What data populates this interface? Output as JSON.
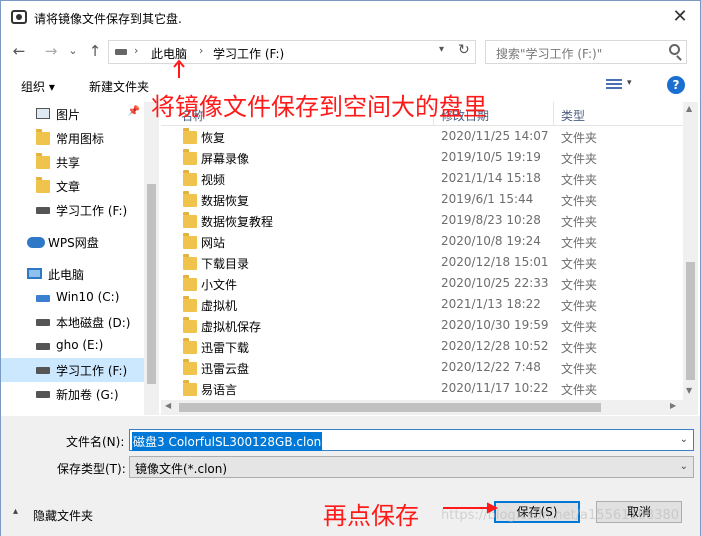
{
  "window": {
    "title": "请将镜像文件保存到其它盘.",
    "close": "✕"
  },
  "nav": {
    "back": "←",
    "forward": "→",
    "recent": "⌄",
    "up": "↑",
    "breadcrumb": [
      "此电脑",
      "学习工作 (F:)"
    ],
    "refresh": "↻",
    "search_placeholder": "搜索\"学习工作 (F:)\""
  },
  "toolbar": {
    "organize": "组织 ▾",
    "new_folder": "新建文件夹",
    "help": "?"
  },
  "sidebar": {
    "items": [
      {
        "label": "图片",
        "icon": "picture-icon"
      },
      {
        "label": "常用图标",
        "icon": "folder-icon"
      },
      {
        "label": "共享",
        "icon": "folder-icon"
      },
      {
        "label": "文章",
        "icon": "folder-icon"
      },
      {
        "label": "学习工作 (F:)",
        "icon": "drive-icon"
      },
      {
        "label": "WPS网盘",
        "icon": "cloud-icon"
      },
      {
        "label": "此电脑",
        "icon": "computer-icon"
      },
      {
        "label": "Win10 (C:)",
        "icon": "windows-drive-icon"
      },
      {
        "label": "本地磁盘 (D:)",
        "icon": "drive-icon"
      },
      {
        "label": "gho (E:)",
        "icon": "drive-icon"
      },
      {
        "label": "学习工作 (F:)",
        "icon": "drive-icon",
        "selected": true
      },
      {
        "label": "新加卷 (G:)",
        "icon": "drive-icon"
      }
    ]
  },
  "list": {
    "columns": [
      "名称",
      "修改日期",
      "类型"
    ],
    "rows": [
      {
        "name": "恢复",
        "date": "2020/11/25 14:07",
        "type": "文件夹"
      },
      {
        "name": "屏幕录像",
        "date": "2019/10/5 19:19",
        "type": "文件夹"
      },
      {
        "name": "视频",
        "date": "2021/1/14 15:18",
        "type": "文件夹"
      },
      {
        "name": "数据恢复",
        "date": "2019/6/1 15:44",
        "type": "文件夹"
      },
      {
        "name": "数据恢复教程",
        "date": "2019/8/23 10:28",
        "type": "文件夹"
      },
      {
        "name": "网站",
        "date": "2020/10/8 19:24",
        "type": "文件夹"
      },
      {
        "name": "下载目录",
        "date": "2020/12/18 15:01",
        "type": "文件夹"
      },
      {
        "name": "小文件",
        "date": "2020/10/25 22:33",
        "type": "文件夹"
      },
      {
        "name": "虚拟机",
        "date": "2021/1/13 18:22",
        "type": "文件夹"
      },
      {
        "name": "虚拟机保存",
        "date": "2020/10/30 19:59",
        "type": "文件夹"
      },
      {
        "name": "迅雷下载",
        "date": "2020/12/28 10:52",
        "type": "文件夹"
      },
      {
        "name": "迅雷云盘",
        "date": "2020/12/22 7:48",
        "type": "文件夹"
      },
      {
        "name": "易语言",
        "date": "2020/11/17 10:22",
        "type": "文件夹"
      }
    ]
  },
  "form": {
    "filename_label": "文件名(N):",
    "filename_value": "磁盘3 ColorfulSL300128GB.clon",
    "filetype_label": "保存类型(T):",
    "filetype_value": "镜像文件(*.clon)",
    "hide_folders": "隐藏文件夹",
    "save": "保存(S)",
    "cancel": "取消"
  },
  "annotations": {
    "top": "将镜像文件保存到空间大的盘里",
    "bottom": "再点保存",
    "color": "#ff1a1a"
  },
  "watermark": "https://blog.csdn.net/a15561168380"
}
